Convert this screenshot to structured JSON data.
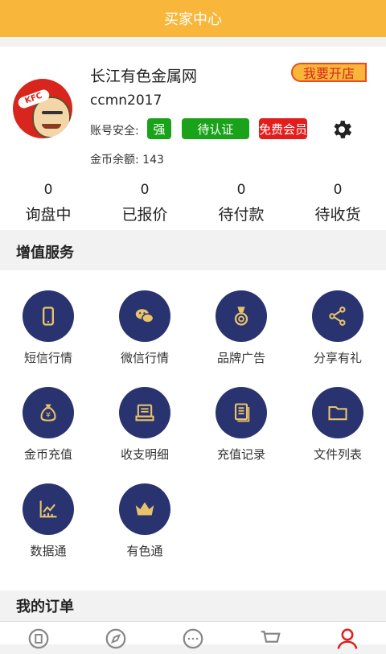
{
  "header": {
    "title": "买家中心"
  },
  "profile": {
    "company": "长江有色金属网",
    "username": "ccmn2017",
    "open_store": "我要开店",
    "security_label": "账号安全:",
    "badges": {
      "strength": "强",
      "certify": "待认证",
      "vip": "免费会员"
    },
    "balance_label": "金币余额:",
    "balance_value": "143",
    "avatar_text": "KFC"
  },
  "stats": [
    {
      "value": "0",
      "label": "询盘中"
    },
    {
      "value": "0",
      "label": "已报价"
    },
    {
      "value": "0",
      "label": "待付款"
    },
    {
      "value": "0",
      "label": "待收货"
    }
  ],
  "services": {
    "title": "增值服务",
    "items": [
      {
        "label": "短信行情",
        "icon": "phone-icon"
      },
      {
        "label": "微信行情",
        "icon": "wechat-icon"
      },
      {
        "label": "品牌广告",
        "icon": "medal-icon"
      },
      {
        "label": "分享有礼",
        "icon": "share-icon"
      },
      {
        "label": "金币充值",
        "icon": "money-bag-icon"
      },
      {
        "label": "收支明细",
        "icon": "ledger-icon"
      },
      {
        "label": "充值记录",
        "icon": "records-icon"
      },
      {
        "label": "文件列表",
        "icon": "folder-icon"
      },
      {
        "label": "数据通",
        "icon": "chart-icon"
      },
      {
        "label": "有色通",
        "icon": "crown-icon"
      }
    ]
  },
  "orders": {
    "title": "我的订单"
  },
  "colors": {
    "header": "#f8b73a",
    "icon_circle": "#283370",
    "icon_accent": "#e8c36a",
    "active_tab": "#e31c1c"
  }
}
